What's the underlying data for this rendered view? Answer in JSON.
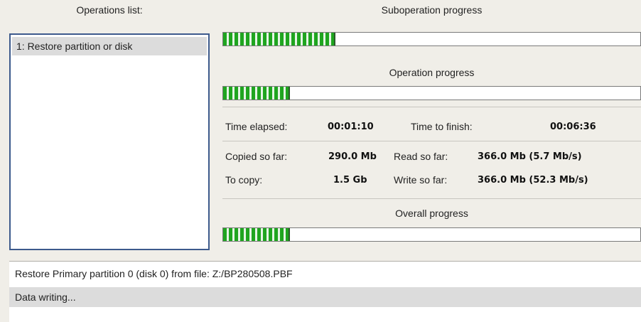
{
  "operations": {
    "header": "Operations list:",
    "items": [
      "1: Restore partition or disk"
    ]
  },
  "suboperation": {
    "label": "Suboperation progress",
    "progress": 0.27
  },
  "operation": {
    "label": "Operation progress",
    "progress": 0.16
  },
  "time": {
    "elapsed_label": "Time elapsed:",
    "elapsed_value": "00:01:10",
    "finish_label": "Time to finish:",
    "finish_value": "00:06:36"
  },
  "stats": {
    "copied_label": "Copied so far:",
    "copied_value": "290.0 Mb",
    "to_copy_label": "To copy:",
    "to_copy_value": "1.5 Gb",
    "read_label": "Read so far:",
    "read_value": "366.0 Mb (5.7 Mb/s)",
    "write_label": "Write so far:",
    "write_value": "366.0 Mb (52.3 Mb/s)"
  },
  "overall": {
    "label": "Overall progress",
    "progress": 0.16
  },
  "log": {
    "line1": "Restore Primary partition 0 (disk 0) from file: Z:/BP280508.PBF",
    "status": "Data writing..."
  },
  "colors": {
    "bar_fill": "#1fa51f",
    "panel_border": "#3d5a8c",
    "background": "#f0eee8"
  }
}
